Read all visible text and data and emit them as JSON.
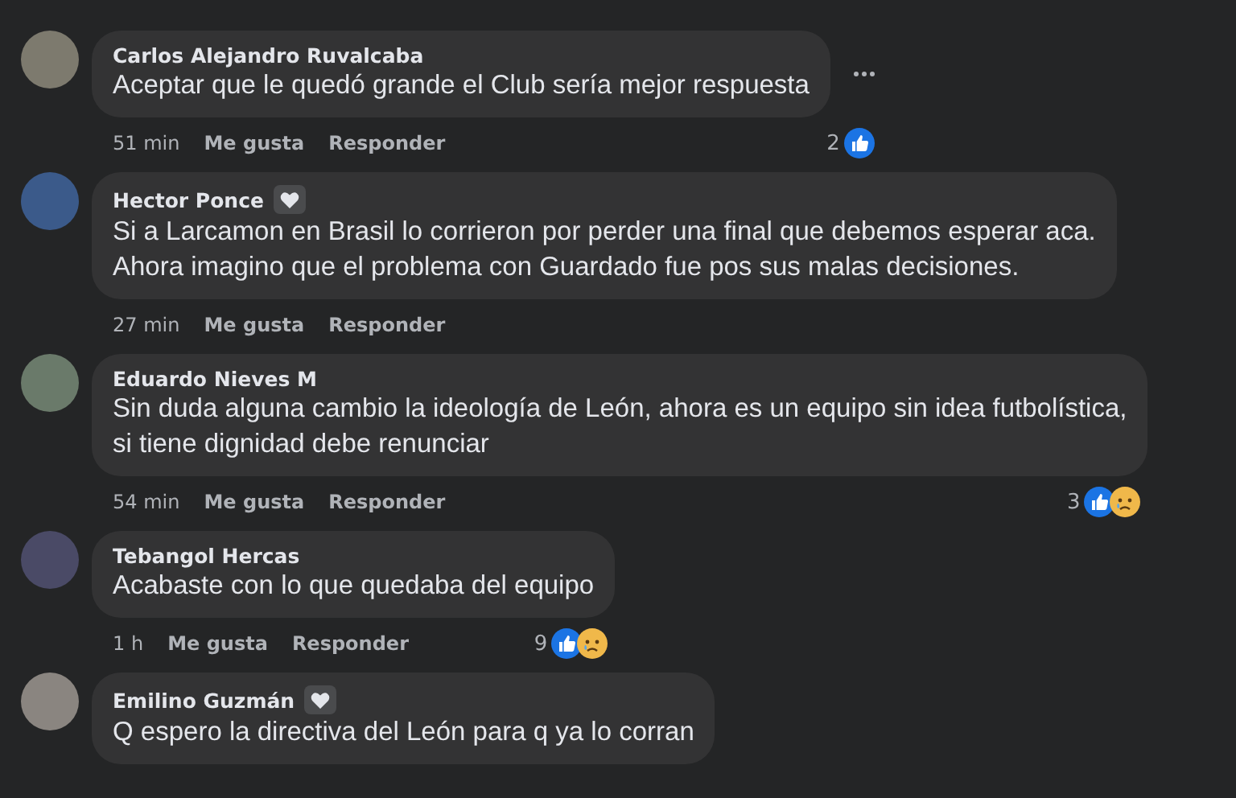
{
  "comments": [
    {
      "author": "Carlos Alejandro Ruvalcaba",
      "top_fan": false,
      "lines": [
        "Aceptar que le quedó grande el Club sería mejor respuesta"
      ],
      "more_button": true,
      "time": "51 min",
      "like_label": "Me gusta",
      "reply_label": "Responder",
      "reaction_count": "2",
      "reactions": [
        {
          "kind": "like"
        }
      ]
    },
    {
      "author": "Hector Ponce",
      "top_fan": true,
      "lines": [
        "Si a Larcamon en Brasil lo corrieron por perder una final que debemos esperar aca.",
        "Ahora imagino que el problema con Guardado fue pos sus malas decisiones."
      ],
      "more_button": false,
      "time": "27 min",
      "like_label": "Me gusta",
      "reply_label": "Responder"
    },
    {
      "author": "Eduardo Nieves M",
      "top_fan": false,
      "lines": [
        "Sin duda alguna cambio la ideología de León, ahora es un equipo sin idea futbolística,",
        "si tiene dignidad debe renunciar"
      ],
      "more_button": false,
      "time": "54 min",
      "like_label": "Me gusta",
      "reply_label": "Responder",
      "reaction_count": "3",
      "reactions": [
        {
          "kind": "like"
        },
        {
          "kind": "sad"
        }
      ]
    },
    {
      "author": "Tebangol Hercas",
      "top_fan": false,
      "lines": [
        "Acabaste con lo que quedaba del equipo"
      ],
      "more_button": false,
      "time": "1 h",
      "like_label": "Me gusta",
      "reply_label": "Responder",
      "reaction_count": "9",
      "reactions": [
        {
          "kind": "like"
        },
        {
          "kind": "sad"
        }
      ]
    },
    {
      "author": "Emilino Guzmán",
      "top_fan": true,
      "lines": [
        "Q espero la directiva del León para q ya lo corran"
      ],
      "more_button": false
    }
  ]
}
